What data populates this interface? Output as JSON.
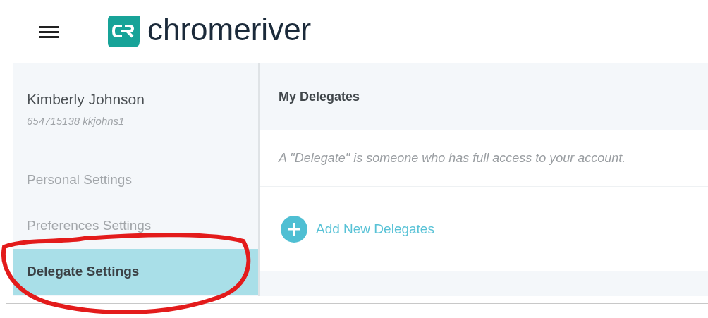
{
  "header": {
    "logo_text": "chromeriver"
  },
  "sidebar": {
    "user_name": "Kimberly Johnson",
    "user_id": "654715138 kkjohns1",
    "items": [
      {
        "label": "Personal Settings",
        "selected": false
      },
      {
        "label": "Preferences Settings",
        "selected": false
      },
      {
        "label": "Delegate Settings",
        "selected": true
      }
    ]
  },
  "main": {
    "title": "My Delegates",
    "description": "A \"Delegate\" is someone who has full access to your account.",
    "add_link": "Add New Delegates"
  }
}
